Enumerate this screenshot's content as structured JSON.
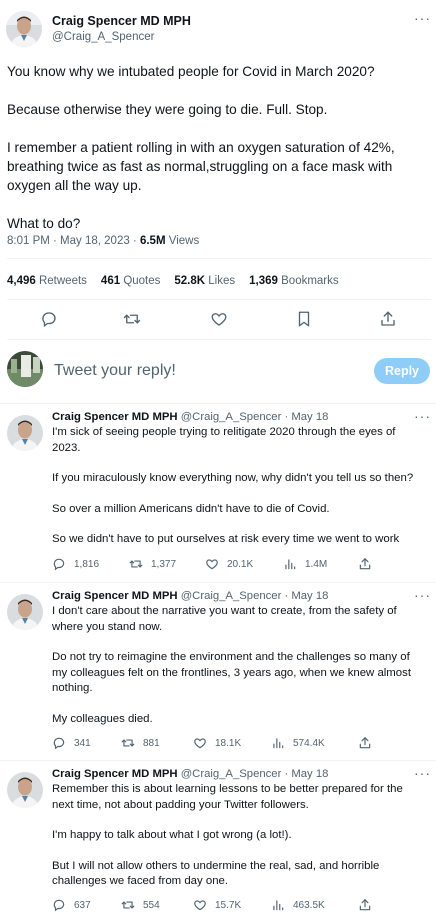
{
  "main_tweet": {
    "author_name": "Craig Spencer MD MPH",
    "author_handle": "@Craig_A_Spencer",
    "more_label": "···",
    "paragraphs": [
      "You know why we intubated people for Covid in March 2020?",
      "Because otherwise they were going to die. Full. Stop.",
      "I remember a patient rolling in with an oxygen saturation of 42%, breathing twice as fast as normal,struggling on a face mask with oxygen all the way up.",
      "What to do?"
    ],
    "timestamp": "8:01 PM · May 18, 2023 · ",
    "views_count": "6.5M",
    "views_label": " Views",
    "stats": [
      {
        "count": "4,496",
        "label": "Retweets"
      },
      {
        "count": "461",
        "label": "Quotes"
      },
      {
        "count": "52.8K",
        "label": "Likes"
      },
      {
        "count": "1,369",
        "label": "Bookmarks"
      }
    ],
    "action_icons": [
      "reply-icon",
      "retweet-icon",
      "like-icon",
      "bookmark-icon",
      "share-icon"
    ]
  },
  "composer": {
    "placeholder": "Tweet your reply!",
    "reply_button": "Reply"
  },
  "replies": [
    {
      "author_name": "Craig Spencer MD MPH",
      "author_handle": "@Craig_A_Spencer",
      "date": " · May 18",
      "paragraphs": [
        "I'm sick of seeing people trying to relitigate 2020 through the eyes of 2023.",
        "If you miraculously know everything now, why didn't you tell us so then?",
        "So over a million Americans didn't have to die of Covid.",
        "So we didn't have to put ourselves at risk every time we went to work"
      ],
      "replies": "1,816",
      "retweets": "1,377",
      "likes": "20.1K",
      "views": "1.4M"
    },
    {
      "author_name": "Craig Spencer MD MPH",
      "author_handle": "@Craig_A_Spencer",
      "date": " · May 18",
      "paragraphs": [
        "I don't care about the narrative you want to create, from the safety of where you stand now.",
        "Do not try to reimagine the environment and the challenges so many of my colleagues felt on the frontlines, 3 years ago, when we knew almost nothing.",
        "My colleagues died."
      ],
      "replies": "341",
      "retweets": "881",
      "likes": "18.1K",
      "views": "574.4K"
    },
    {
      "author_name": "Craig Spencer MD MPH",
      "author_handle": "@Craig_A_Spencer",
      "date": " · May 18",
      "paragraphs": [
        "Remember this is about learning lessons to be better prepared for the next time, not about padding your Twitter followers.",
        "I'm happy to talk about what I got wrong (a lot!).",
        "But I will not allow others to undermine the real, sad, and horrible challenges we faced from day one."
      ],
      "replies": "637",
      "retweets": "554",
      "likes": "15.7K",
      "views": "463.5K"
    }
  ],
  "colors": {
    "text": "#0f1419",
    "secondary": "#536471",
    "reply_button": "#8ecdf8",
    "divider": "#eff3f4"
  }
}
